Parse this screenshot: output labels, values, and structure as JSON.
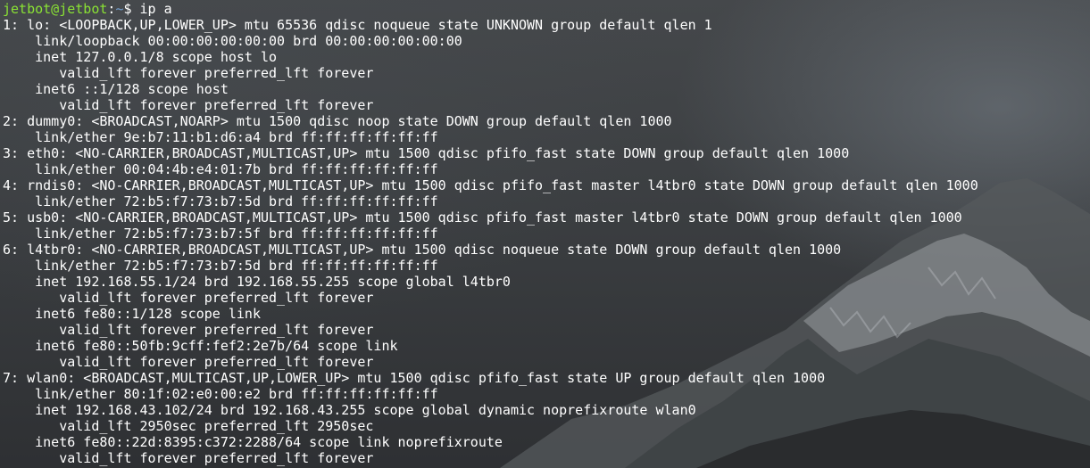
{
  "prompt": {
    "user_host": "jetbot@jetbot",
    "separator": ":",
    "path": "~",
    "symbol": "$ ",
    "command": "ip a"
  },
  "output": [
    "1: lo: <LOOPBACK,UP,LOWER_UP> mtu 65536 qdisc noqueue state UNKNOWN group default qlen 1",
    "    link/loopback 00:00:00:00:00:00 brd 00:00:00:00:00:00",
    "    inet 127.0.0.1/8 scope host lo",
    "       valid_lft forever preferred_lft forever",
    "    inet6 ::1/128 scope host",
    "       valid_lft forever preferred_lft forever",
    "2: dummy0: <BROADCAST,NOARP> mtu 1500 qdisc noop state DOWN group default qlen 1000",
    "    link/ether 9e:b7:11:b1:d6:a4 brd ff:ff:ff:ff:ff:ff",
    "3: eth0: <NO-CARRIER,BROADCAST,MULTICAST,UP> mtu 1500 qdisc pfifo_fast state DOWN group default qlen 1000",
    "    link/ether 00:04:4b:e4:01:7b brd ff:ff:ff:ff:ff:ff",
    "4: rndis0: <NO-CARRIER,BROADCAST,MULTICAST,UP> mtu 1500 qdisc pfifo_fast master l4tbr0 state DOWN group default qlen 1000",
    "    link/ether 72:b5:f7:73:b7:5d brd ff:ff:ff:ff:ff:ff",
    "5: usb0: <NO-CARRIER,BROADCAST,MULTICAST,UP> mtu 1500 qdisc pfifo_fast master l4tbr0 state DOWN group default qlen 1000",
    "    link/ether 72:b5:f7:73:b7:5f brd ff:ff:ff:ff:ff:ff",
    "6: l4tbr0: <NO-CARRIER,BROADCAST,MULTICAST,UP> mtu 1500 qdisc noqueue state DOWN group default qlen 1000",
    "    link/ether 72:b5:f7:73:b7:5d brd ff:ff:ff:ff:ff:ff",
    "    inet 192.168.55.1/24 brd 192.168.55.255 scope global l4tbr0",
    "       valid_lft forever preferred_lft forever",
    "    inet6 fe80::1/128 scope link",
    "       valid_lft forever preferred_lft forever",
    "    inet6 fe80::50fb:9cff:fef2:2e7b/64 scope link",
    "       valid_lft forever preferred_lft forever",
    "7: wlan0: <BROADCAST,MULTICAST,UP,LOWER_UP> mtu 1500 qdisc pfifo_fast state UP group default qlen 1000",
    "    link/ether 80:1f:02:e0:00:e2 brd ff:ff:ff:ff:ff:ff",
    "    inet 192.168.43.102/24 brd 192.168.43.255 scope global dynamic noprefixroute wlan0",
    "       valid_lft 2950sec preferred_lft 2950sec",
    "    inet6 fe80::22d:8395:c372:2288/64 scope link noprefixroute",
    "       valid_lft forever preferred_lft forever"
  ],
  "colors": {
    "prompt_user": "#8ae234",
    "prompt_path": "#729fcf",
    "text": "#ffffff"
  },
  "background_icon": "mountain-landscape"
}
